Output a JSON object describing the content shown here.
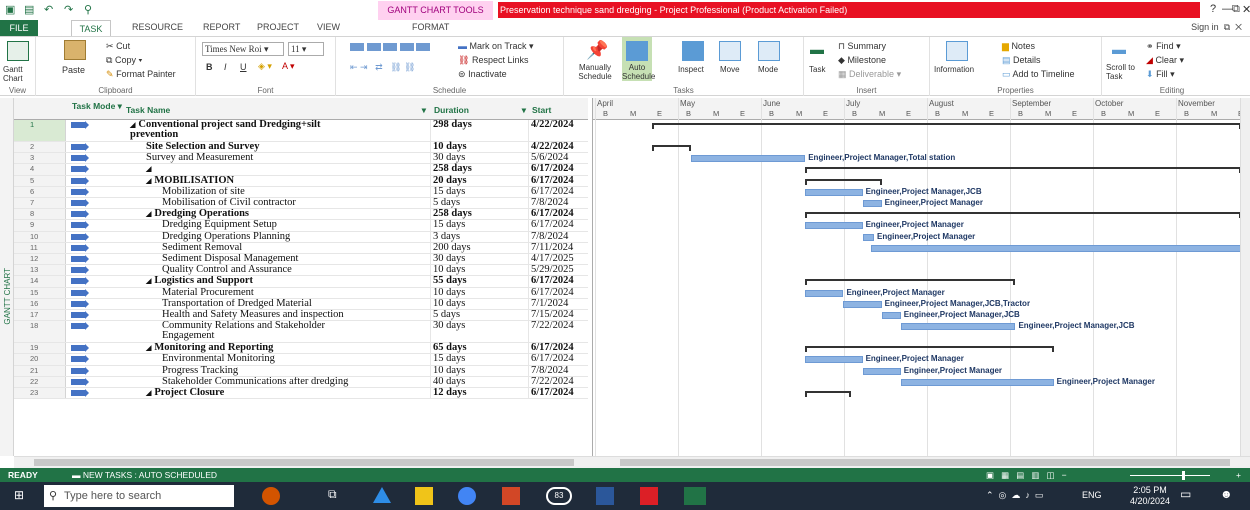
{
  "titlebar": {
    "tools_tab": "GANTT CHART TOOLS",
    "title": "Preservation technique sand dredging  -  Project Professional (Product Activation Failed)",
    "help": "?",
    "minimize": "—",
    "restore": "⧉",
    "close": "✕"
  },
  "tabs": {
    "file": "FILE",
    "task": "TASK",
    "resource": "RESOURCE",
    "report": "REPORT",
    "project": "PROJECT",
    "view": "VIEW",
    "format": "FORMAT",
    "signin": "Sign in"
  },
  "ribbon": {
    "view": {
      "gantt": "Gantt Chart",
      "label": "View"
    },
    "clipboard": {
      "paste": "Paste",
      "cut": "Cut",
      "copy": "Copy",
      "format_painter": "Format Painter",
      "label": "Clipboard"
    },
    "font": {
      "family": "Times New Roi",
      "size": "11",
      "bold": "B",
      "italic": "I",
      "underline": "U",
      "label": "Font"
    },
    "schedule": {
      "mark_on_track": "Mark on Track",
      "respect_links": "Respect Links",
      "inactivate": "Inactivate",
      "label": "Schedule",
      "pcts": [
        "0%",
        "25%",
        "50%",
        "75%",
        "100%"
      ]
    },
    "tasks": {
      "manually": "Manually Schedule",
      "auto": "Auto Schedule",
      "inspect": "Inspect",
      "move": "Move",
      "mode": "Mode",
      "label": "Tasks"
    },
    "insert": {
      "task": "Task",
      "summary": "Summary",
      "milestone": "Milestone",
      "deliverable": "Deliverable",
      "label": "Insert"
    },
    "properties": {
      "information": "Information",
      "notes": "Notes",
      "details": "Details",
      "add_timeline": "Add to Timeline",
      "label": "Properties"
    },
    "editing": {
      "scroll": "Scroll to Task",
      "find": "Find",
      "clear": "Clear",
      "fill": "Fill",
      "label": "Editing"
    }
  },
  "side_label": "GANTT CHART",
  "table": {
    "headers": {
      "mode": "Task Mode",
      "name": "Task Name",
      "duration": "Duration",
      "start": "Start"
    },
    "rows": [
      {
        "num": "1",
        "name": "Conventional project  sand Dredging+silt",
        "name2": "prevention",
        "duration": "298 days",
        "start": "4/22/2024",
        "bold": true,
        "indent": 0,
        "collapse": "◢"
      },
      {
        "num": "2",
        "name": "Site Selection and Survey",
        "duration": "10 days",
        "start": "4/22/2024",
        "bold": true,
        "indent": 1
      },
      {
        "num": "3",
        "name": "Survey and Measurement",
        "duration": "30 days",
        "start": "5/6/2024",
        "bold": false,
        "indent": 1
      },
      {
        "num": "4",
        "name": "",
        "duration": "258 days",
        "start": "6/17/2024",
        "bold": true,
        "indent": 1,
        "collapse": "◢"
      },
      {
        "num": "5",
        "name": "MOBILISATION",
        "duration": "20 days",
        "start": "6/17/2024",
        "bold": true,
        "indent": 1,
        "collapse": "◢"
      },
      {
        "num": "6",
        "name": "Mobilization of site",
        "duration": "15 days",
        "start": "6/17/2024",
        "bold": false,
        "indent": 2
      },
      {
        "num": "7",
        "name": "Mobilisation of Civil contractor",
        "duration": "5 days",
        "start": "7/8/2024",
        "bold": false,
        "indent": 2
      },
      {
        "num": "8",
        "name": "Dredging Operations",
        "duration": "258 days",
        "start": "6/17/2024",
        "bold": true,
        "indent": 1,
        "collapse": "◢"
      },
      {
        "num": "9",
        "name": "Dredging Equipment Setup",
        "duration": "15 days",
        "start": "6/17/2024",
        "bold": false,
        "indent": 2
      },
      {
        "num": "10",
        "name": "Dredging Operations Planning",
        "duration": "3 days",
        "start": "7/8/2024",
        "bold": false,
        "indent": 2
      },
      {
        "num": "11",
        "name": "Sediment Removal",
        "duration": "200 days",
        "start": "7/11/2024",
        "bold": false,
        "indent": 2
      },
      {
        "num": "12",
        "name": "Sediment Disposal Management",
        "duration": "30 days",
        "start": "4/17/2025",
        "bold": false,
        "indent": 2
      },
      {
        "num": "13",
        "name": "Quality Control and Assurance",
        "duration": "10 days",
        "start": "5/29/2025",
        "bold": false,
        "indent": 2
      },
      {
        "num": "14",
        "name": "Logistics and Support",
        "duration": "55 days",
        "start": "6/17/2024",
        "bold": true,
        "indent": 1,
        "collapse": "◢"
      },
      {
        "num": "15",
        "name": "Material Procurement",
        "duration": "10 days",
        "start": "6/17/2024",
        "bold": false,
        "indent": 2
      },
      {
        "num": "16",
        "name": "Transportation of Dredged Material",
        "duration": "10 days",
        "start": "7/1/2024",
        "bold": false,
        "indent": 2
      },
      {
        "num": "17",
        "name": "Health and Safety Measures and inspection",
        "duration": "5 days",
        "start": "7/15/2024",
        "bold": false,
        "indent": 2
      },
      {
        "num": "18",
        "name": "Community Relations and Stakeholder",
        "name2": "Engagement",
        "duration": "30 days",
        "start": "7/22/2024",
        "bold": false,
        "indent": 2
      },
      {
        "num": "19",
        "name": "Monitoring and Reporting",
        "duration": "65 days",
        "start": "6/17/2024",
        "bold": true,
        "indent": 1,
        "collapse": "◢"
      },
      {
        "num": "20",
        "name": "Environmental Monitoring",
        "duration": "15 days",
        "start": "6/17/2024",
        "bold": false,
        "indent": 2
      },
      {
        "num": "21",
        "name": "Progress Tracking",
        "duration": "10 days",
        "start": "7/8/2024",
        "bold": false,
        "indent": 2
      },
      {
        "num": "22",
        "name": "Stakeholder Communications after dredging",
        "duration": "40 days",
        "start": "7/22/2024",
        "bold": false,
        "indent": 2
      },
      {
        "num": "23",
        "name": "Project Closure",
        "duration": "12 days",
        "start": "6/17/2024",
        "bold": true,
        "indent": 1,
        "collapse": "◢"
      }
    ]
  },
  "gantt": {
    "months": [
      "April",
      "May",
      "June",
      "July",
      "August",
      "September",
      "October",
      "November"
    ],
    "subs": [
      "B",
      "M",
      "E"
    ],
    "labels": {
      "r3": "Engineer,Project Manager,Total station",
      "r6": "Engineer,Project Manager,JCB",
      "r7": "Engineer,Project Manager",
      "r9": "Engineer,Project Manager",
      "r10": "Engineer,Project Manager",
      "r15": "Engineer,Project Manager",
      "r16": "Engineer,Project Manager,JCB,Tractor",
      "r17": "Engineer,Project Manager,JCB",
      "r18": "Engineer,Project Manager,JCB",
      "r20": "Engineer,Project Manager",
      "r21": "Engineer,Project Manager",
      "r22": "Engineer,Project Manager"
    }
  },
  "status": {
    "ready": "READY",
    "new_tasks": "NEW TASKS : AUTO SCHEDULED"
  },
  "taskbar": {
    "search": "Type here to search",
    "time": "2:05 PM",
    "date": "4/20/2024",
    "lang": "ENG",
    "whatsapp_badge": "83"
  },
  "colors": {
    "accent": "#217346",
    "title_red": "#e81123",
    "bar": "#8db3e2"
  }
}
